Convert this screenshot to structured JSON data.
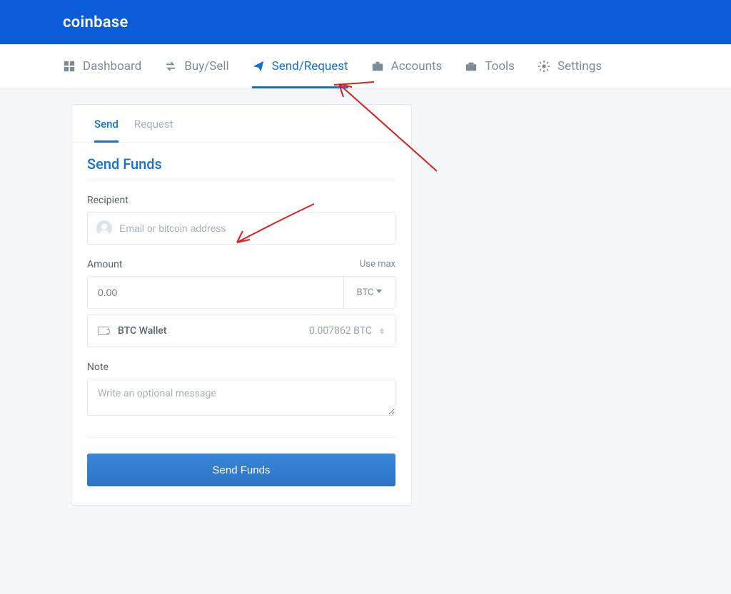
{
  "brand": "coinbase",
  "nav": {
    "items": [
      {
        "label": "Dashboard"
      },
      {
        "label": "Buy/Sell"
      },
      {
        "label": "Send/Request",
        "active": true
      },
      {
        "label": "Accounts"
      },
      {
        "label": "Tools"
      },
      {
        "label": "Settings"
      }
    ]
  },
  "card": {
    "tabs": {
      "send": "Send",
      "request": "Request",
      "active": "send"
    },
    "title": "Send Funds",
    "recipient_label": "Recipient",
    "recipient_placeholder": "Email or bitcoin address",
    "amount_label": "Amount",
    "amount_use_max": "Use max",
    "amount_value": "0.00",
    "currency": "BTC",
    "wallet_name": "BTC Wallet",
    "wallet_balance": "0.007862 BTC",
    "note_label": "Note",
    "note_placeholder": "Write an optional message",
    "submit": "Send Funds"
  }
}
